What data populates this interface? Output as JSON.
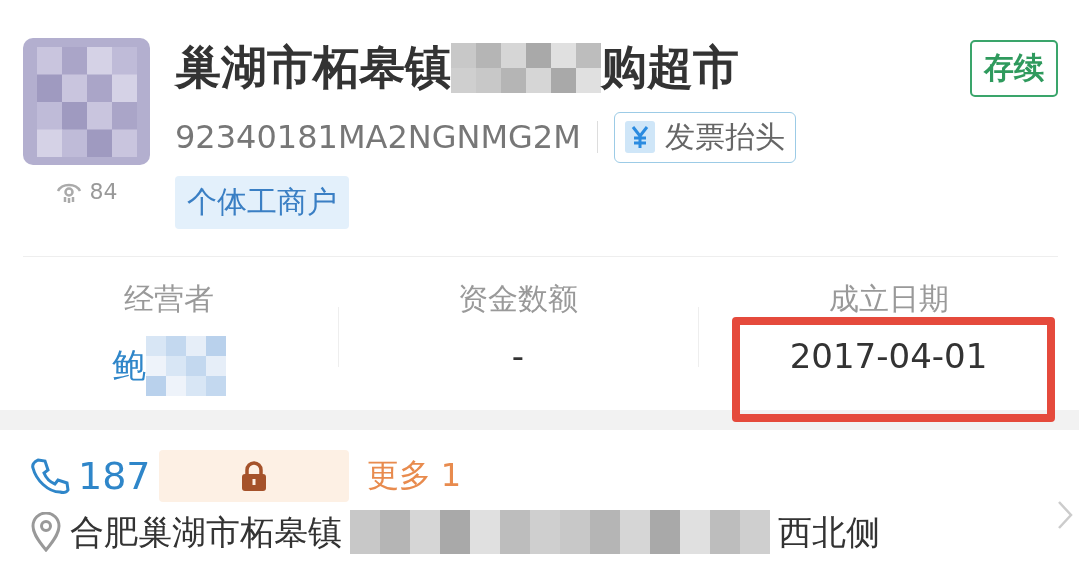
{
  "company": {
    "views": "84",
    "name_parts": [
      "巢湖市柘皋镇",
      "购超市"
    ],
    "status": "存续",
    "credit_code": "92340181MA2NGNMG2M",
    "invoice_button": "发票抬头",
    "type_tag": "个体工商户"
  },
  "stats": [
    {
      "label": "经营者",
      "value": "鲍",
      "kind": "link",
      "highlighted": false
    },
    {
      "label": "资金数额",
      "value": "-",
      "kind": "plain",
      "highlighted": false
    },
    {
      "label": "成立日期",
      "value": "2017-04-01",
      "kind": "plain",
      "highlighted": true
    }
  ],
  "contact": {
    "phone": "187",
    "more": "更多 1"
  },
  "address": {
    "parts": [
      "合肥巢湖市柘皋镇",
      "西北侧"
    ]
  }
}
